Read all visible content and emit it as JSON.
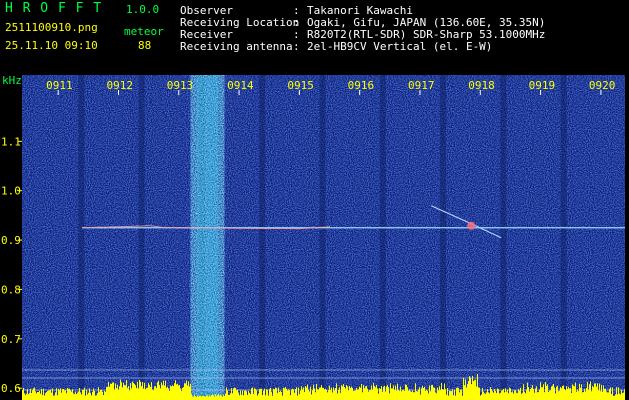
{
  "header": {
    "logo": "H R O F F T",
    "version": "1.0.0",
    "filename": "2511100910.png",
    "datetime": "25.11.10 09:10",
    "meteor_label": "meteor",
    "meteor_count": "88",
    "labels": [
      "Observer",
      "Receiving Location",
      "Receiver",
      "Receiving antenna"
    ],
    "separator": ":",
    "values": [
      "Takanori Kawachi",
      "Ogaki, Gifu, JAPAN (136.60E, 35.35N)",
      "R820T2(RTL-SDR) SDR-Sharp 53.1000MHz",
      "2el-HB9CV Vertical (el. E-W)"
    ]
  },
  "spectrogram": {
    "y_unit": "kHz",
    "x_ticks": [
      "0911",
      "0912",
      "0913",
      "0914",
      "0915",
      "0916",
      "0917",
      "0918",
      "0919",
      "0920"
    ],
    "y_ticks": [
      "1.1",
      "1.0",
      "0.9",
      "0.8",
      "0.7",
      "0.6"
    ],
    "y_tick_values": [
      1.1,
      1.0,
      0.9,
      0.8,
      0.7,
      0.6
    ],
    "y_range": [
      0.576,
      1.2
    ],
    "x_range_minutes": [
      0,
      10
    ],
    "carrier_khz": 0.925,
    "bright_band_minutes": [
      2.8,
      3.35
    ],
    "meteor_echo_minutes": 7.45,
    "colors": {
      "background": "#0a1a7a",
      "noise": "#1f4fd0",
      "bright": "#2ad8ff",
      "carrier": "#9ad8ff",
      "activity_bar": "#ffff00",
      "text_green": "#00ff40",
      "text_yellow": "#ffff00"
    }
  }
}
